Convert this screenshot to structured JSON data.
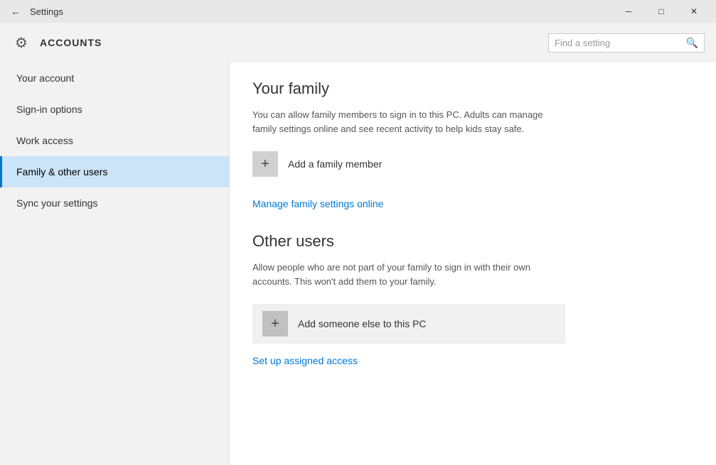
{
  "titleBar": {
    "title": "Settings",
    "backIcon": "←",
    "minimizeIcon": "─",
    "maximizeIcon": "□",
    "closeIcon": "✕"
  },
  "header": {
    "icon": "⚙",
    "title": "ACCOUNTS",
    "searchPlaceholder": "Find a setting",
    "searchIcon": "🔍"
  },
  "sidebar": {
    "items": [
      {
        "id": "your-account",
        "label": "Your account",
        "active": false
      },
      {
        "id": "sign-in-options",
        "label": "Sign-in options",
        "active": false
      },
      {
        "id": "work-access",
        "label": "Work access",
        "active": false
      },
      {
        "id": "family-other-users",
        "label": "Family & other users",
        "active": true
      },
      {
        "id": "sync-your-settings",
        "label": "Sync your settings",
        "active": false
      }
    ]
  },
  "main": {
    "familySection": {
      "title": "Your family",
      "description": "You can allow family members to sign in to this PC. Adults can manage family settings online and see recent activity to help kids stay safe.",
      "addButtonLabel": "Add a family member",
      "manageLink": "Manage family settings online"
    },
    "otherUsersSection": {
      "title": "Other users",
      "description": "Allow people who are not part of your family to sign in with their own accounts. This won't add them to your family.",
      "addButtonLabel": "Add someone else to this PC",
      "setupLink": "Set up assigned access"
    }
  }
}
